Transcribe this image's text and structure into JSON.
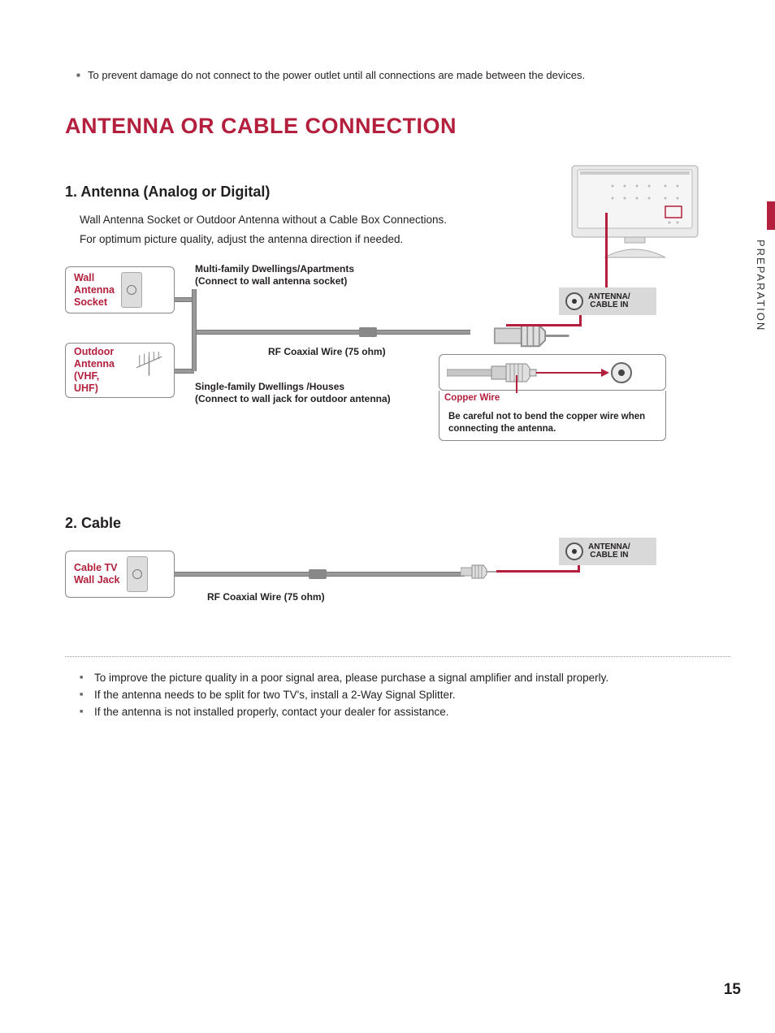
{
  "top_note": "To prevent damage do not connect to the power outlet until all connections are made between the devices.",
  "main_title": "ANTENNA OR CABLE CONNECTION",
  "side_label": "PREPARATION",
  "section1": {
    "heading": "1. Antenna (Analog or Digital)",
    "p1": "Wall Antenna Socket or Outdoor Antenna without a Cable Box Connections.",
    "p2": "For optimum picture quality, adjust the antenna direction if needed.",
    "wall_socket_label": "Wall\nAntenna\nSocket",
    "outdoor_antenna_label": "Outdoor\nAntenna\n(VHF, UHF)",
    "caption_multi1": "Multi-family Dwellings/Apartments",
    "caption_multi2": "(Connect to wall antenna socket)",
    "caption_single1": "Single-family Dwellings /Houses",
    "caption_single2": "(Connect to wall jack for outdoor antenna)",
    "rf_label": "RF Coaxial Wire (75 ohm)",
    "port_label1": "ANTENNA/",
    "port_label2": "CABLE IN",
    "copper_wire": "Copper Wire",
    "copper_note": "Be careful not to bend the copper wire when connecting the antenna."
  },
  "section2": {
    "heading": "2. Cable",
    "cable_jack_label": "Cable TV\nWall Jack",
    "rf_label": "RF Coaxial Wire (75 ohm)",
    "port_label1": "ANTENNA/",
    "port_label2": "CABLE IN"
  },
  "notes": {
    "n1": "To improve the picture quality in a poor signal area, please purchase a signal amplifier and install properly.",
    "n2": "If the antenna needs to be split for two TV's, install a 2-Way Signal Splitter.",
    "n3": "If the antenna is not installed properly, contact your dealer for assistance."
  },
  "page_number": "15"
}
